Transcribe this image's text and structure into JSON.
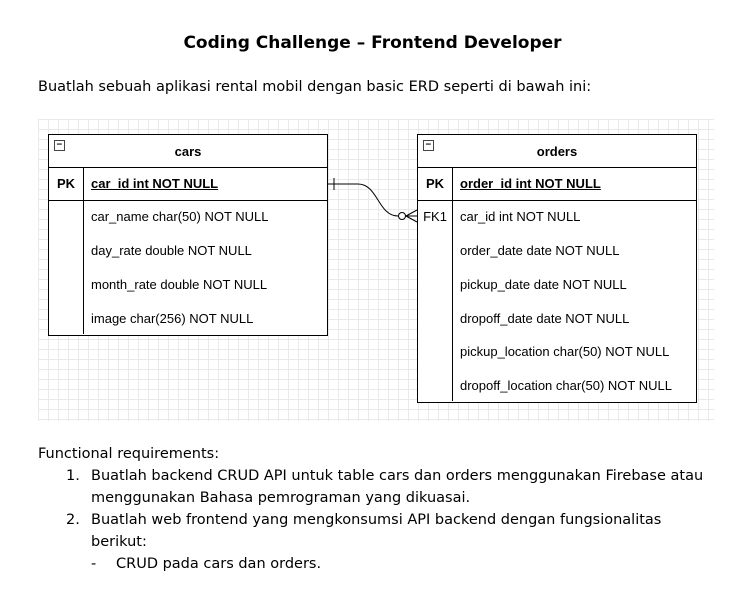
{
  "document": {
    "title": "Coding Challenge – Frontend Developer",
    "intro": "Buatlah sebuah aplikasi rental mobil dengan basic ERD seperti di bawah ini:"
  },
  "erd": {
    "cars": {
      "name": "cars",
      "collapse_symbol": "⊟",
      "pk_label": "PK",
      "pk_field": "car_id int NOT NULL",
      "fields": [
        "car_name char(50) NOT NULL",
        "day_rate double NOT NULL",
        "month_rate double NOT NULL",
        "image char(256) NOT NULL"
      ]
    },
    "orders": {
      "name": "orders",
      "collapse_symbol": "⊟",
      "pk_label": "PK",
      "pk_field": "order_id int NOT NULL",
      "fk_label": "FK1",
      "fields": [
        "car_id int NOT NULL",
        "order_date date NOT NULL",
        "pickup_date date NOT NULL",
        "dropoff_date date NOT NULL",
        "pickup_location char(50) NOT NULL",
        "dropoff_location char(50) NOT NULL"
      ]
    },
    "relationship": "one-to-many",
    "grid": true
  },
  "requirements": {
    "heading": "Functional requirements:",
    "items": [
      {
        "number": "1.",
        "lines": [
          "Buatlah backend CRUD API untuk table cars dan orders menggunakan Firebase atau",
          "menggunakan Bahasa pemrograman yang dikuasai."
        ]
      },
      {
        "number": "2.",
        "lines": [
          "Buatlah web frontend yang mengkonsumsi API backend dengan fungsionalitas berikut:"
        ],
        "sub": {
          "bullet": "-",
          "text": "CRUD pada cars dan orders."
        }
      }
    ]
  }
}
